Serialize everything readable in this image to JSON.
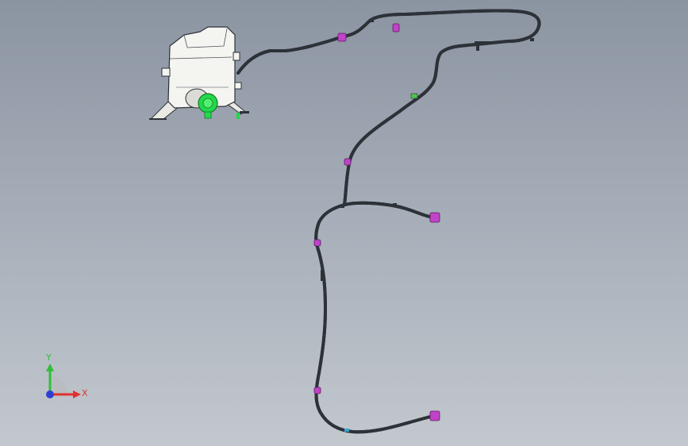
{
  "viewport": {
    "background_top": "#8b94a1",
    "background_bottom": "#c3c8ce"
  },
  "model": {
    "tank": "washer-reservoir",
    "pump": "washer-pump",
    "hose": "washer-hose",
    "connectors": "hose-connector",
    "nozzles": "washer-nozzle"
  },
  "colors": {
    "hose": "#f2f4f6",
    "hose_edge": "#2d3238",
    "tank": "#f4f4f0",
    "pump": "#22d94a",
    "connector": "#c043c8",
    "axis_x": "#e23030",
    "axis_y": "#2fbf3a",
    "axis_z": "#2f3fd6"
  },
  "triad": {
    "x_label": "X",
    "y_label": "Y"
  }
}
